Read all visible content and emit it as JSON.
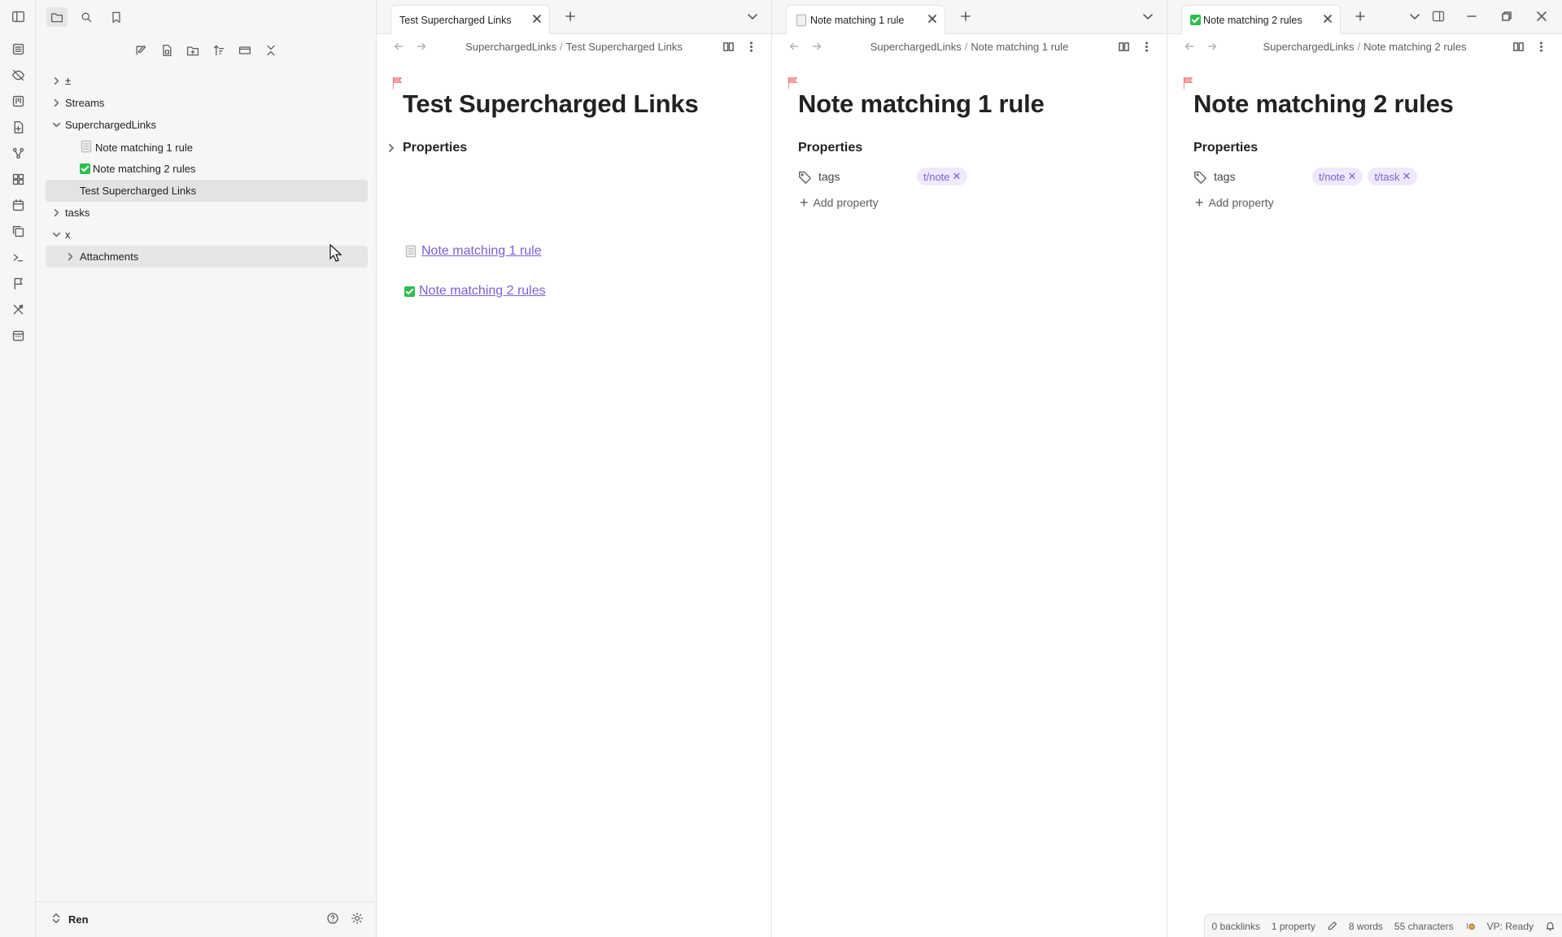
{
  "sidebar": {
    "tree": [
      {
        "label": "±",
        "type": "folder",
        "expanded": false
      },
      {
        "label": "Streams",
        "type": "folder",
        "expanded": false
      },
      {
        "label": "SuperchargedLinks",
        "type": "folder",
        "expanded": true
      },
      {
        "label": "Note matching 1 rule",
        "type": "file-note"
      },
      {
        "label": "Note matching 2 rules",
        "type": "file-task"
      },
      {
        "label": "Test Supercharged Links",
        "type": "file",
        "selected": true
      },
      {
        "label": "tasks",
        "type": "folder",
        "expanded": false
      },
      {
        "label": "x",
        "type": "folder",
        "expanded": true
      },
      {
        "label": "Attachments",
        "type": "folder",
        "expanded": false
      }
    ],
    "vault_name": "Ren"
  },
  "panes": [
    {
      "tab_title": "Test Supercharged Links",
      "breadcrumb": {
        "folder": "SuperchargedLinks",
        "separator": "/",
        "file": "Test Supercharged Links"
      },
      "title": "Test Supercharged Links",
      "properties_label": "Properties",
      "links": [
        "Note matching 1 rule",
        "Note matching 2 rules"
      ]
    },
    {
      "tab_title": "Note matching 1 rule",
      "breadcrumb": {
        "folder": "SuperchargedLinks",
        "separator": "/",
        "file": "Note matching 1 rule"
      },
      "title": "Note matching 1 rule",
      "properties_label": "Properties",
      "prop_key": "tags",
      "tags": [
        "t/note"
      ],
      "add_property": "Add property"
    },
    {
      "tab_title": "Note matching 2 rules",
      "breadcrumb": {
        "folder": "SuperchargedLinks",
        "separator": "/",
        "file": "Note matching 2 rules"
      },
      "title": "Note matching 2 rules",
      "properties_label": "Properties",
      "prop_key": "tags",
      "tags": [
        "t/note",
        "t/task"
      ],
      "add_property": "Add property"
    }
  ],
  "statusbar": {
    "backlinks": "0 backlinks",
    "properties": "1 property",
    "words": "8 words",
    "characters": "55 characters",
    "vp": "VP: Ready"
  },
  "colors": {
    "accent": "#7a5fd6",
    "tag_bg": "#efe9fd",
    "task_green": "#2fbe4f",
    "flag_red": "#f07b7b"
  }
}
